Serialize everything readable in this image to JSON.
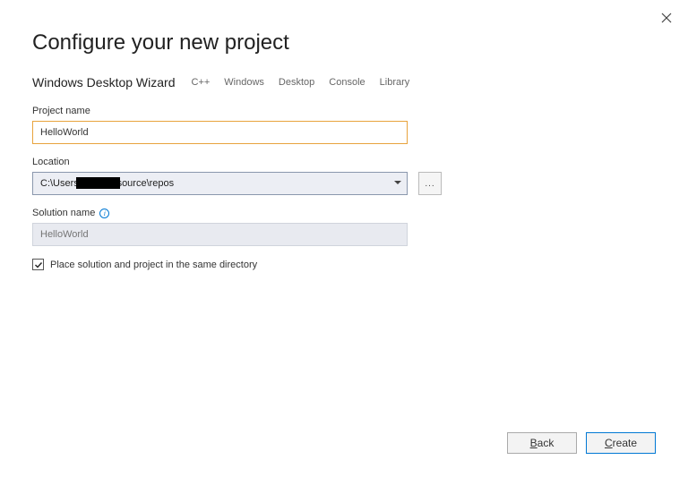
{
  "window": {
    "title": "Configure your new project"
  },
  "template": {
    "name": "Windows Desktop Wizard",
    "tags": [
      "C++",
      "Windows",
      "Desktop",
      "Console",
      "Library"
    ]
  },
  "fields": {
    "projectName": {
      "label": "Project name",
      "value": "HelloWorld"
    },
    "location": {
      "label": "Location",
      "value": "C:\\Users\\            \\source\\repos",
      "browseLabel": "..."
    },
    "solutionName": {
      "label": "Solution name",
      "placeholder": "HelloWorld",
      "value": ""
    },
    "sameDirectory": {
      "label": "Place solution and project in the same directory",
      "checked": true
    }
  },
  "buttons": {
    "back": "Back",
    "create": "Create"
  }
}
